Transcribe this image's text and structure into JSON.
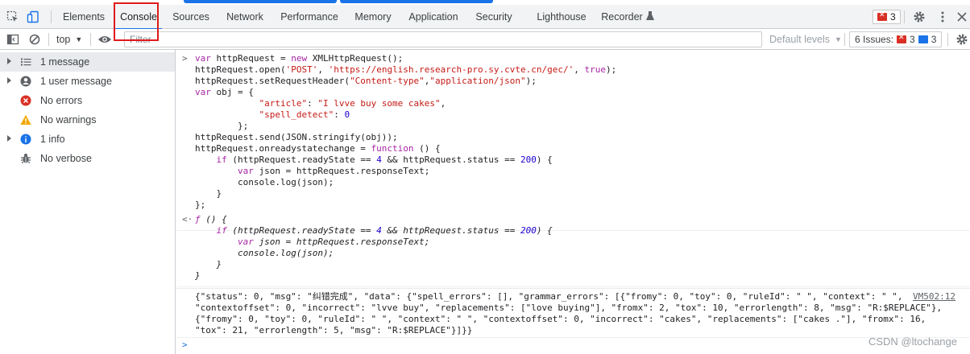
{
  "tabs": [
    "Elements",
    "Console",
    "Sources",
    "Network",
    "Performance",
    "Memory",
    "Application",
    "Security",
    "Lighthouse",
    "Recorder"
  ],
  "active_tab": "Console",
  "error_count": "3",
  "filter": {
    "context": "top",
    "placeholder": "Filter",
    "levels": "Default levels",
    "issues_label": "6 Issues:",
    "issues_errors": "3",
    "issues_info": "3"
  },
  "sidebar": {
    "items": [
      {
        "label": "1 message",
        "icon": "list-icon"
      },
      {
        "label": "1 user message",
        "icon": "user-icon"
      },
      {
        "label": "No errors",
        "icon": "error-icon"
      },
      {
        "label": "No warnings",
        "icon": "warning-icon"
      },
      {
        "label": "1 info",
        "icon": "info-icon"
      },
      {
        "label": "No verbose",
        "icon": "bug-icon"
      }
    ]
  },
  "console": {
    "source_link": "VM502:12",
    "watermark": "CSDN @ltochange"
  },
  "colors": {
    "accent": "#1a73e8",
    "error": "#d93025",
    "highlight_box": "#e0191b"
  }
}
